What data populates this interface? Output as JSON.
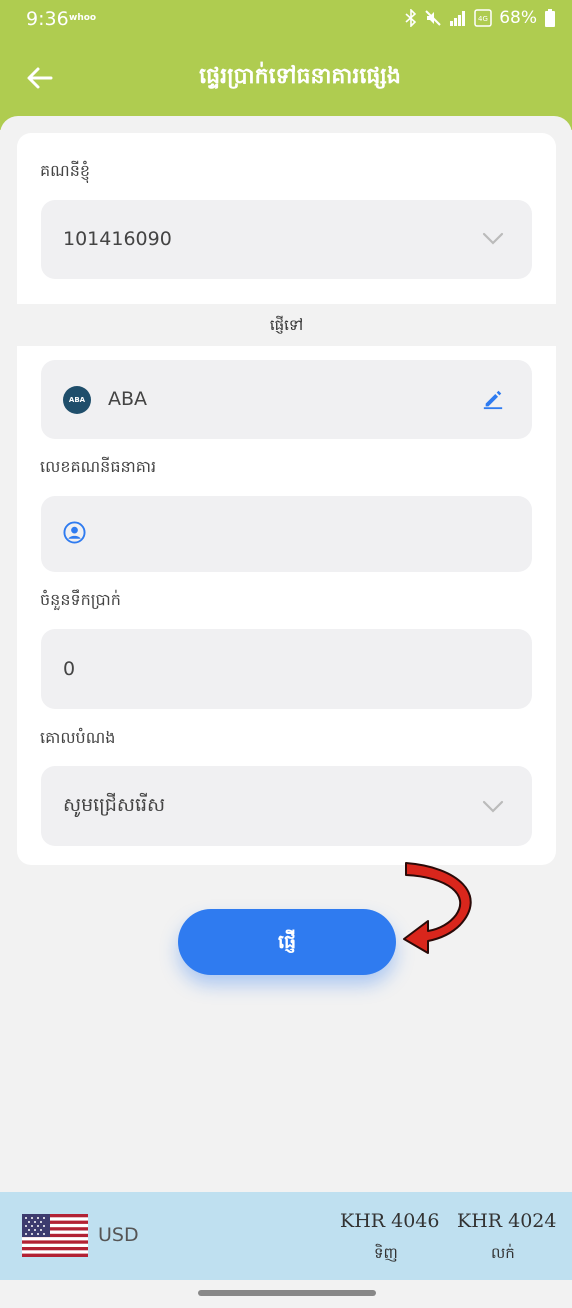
{
  "status": {
    "time": "9:36",
    "carrier": "whoo",
    "battery": "68%",
    "lte": "4G"
  },
  "header": {
    "title": "ផ្ទេរប្រាក់ទៅធនាគារផ្សេង"
  },
  "form": {
    "my_account_label": "គណនីខ្ញុំ",
    "my_account_value": "101416090",
    "send_to_label": "ផ្ញើទៅ",
    "bank_logo_text": "ABA",
    "bank_name": "ABA",
    "account_number_label": "លេខគណនីធនាគារ",
    "account_number_value": "",
    "amount_label": "ចំនួនទឹកប្រាក់",
    "amount_value": "0",
    "purpose_label": "គោលបំណង",
    "purpose_value": "សូមជ្រើសរើស"
  },
  "send_button": {
    "label": "ផ្ញើ"
  },
  "exchange": {
    "currency": "USD",
    "buy_rate": "KHR 4046",
    "buy_label": "ទិញ",
    "sell_rate": "KHR 4024",
    "sell_label": "លក់"
  },
  "colors": {
    "header": "#afcc50",
    "primary": "#2f7bf0",
    "fx_bar": "#bfe0f0",
    "annotation_arrow": "#d9261c"
  }
}
